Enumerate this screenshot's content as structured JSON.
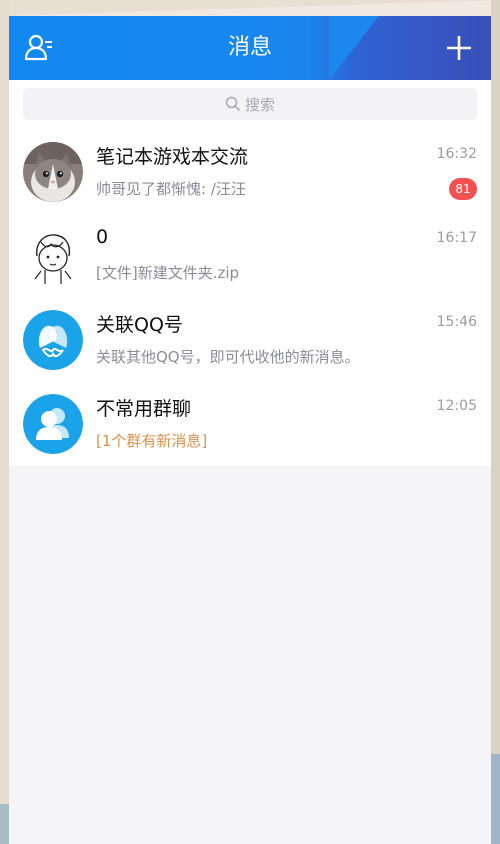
{
  "header": {
    "title": "消息",
    "left_icon": "contacts-icon",
    "right_icon": "plus-icon",
    "accent": "#1289f0"
  },
  "search": {
    "placeholder": "搜索",
    "icon": "search-icon"
  },
  "conversations": [
    {
      "name": "笔记本游戏本交流",
      "preview": "帅哥见了都惭愧: /汪汪",
      "time": "16:32",
      "unread": "81",
      "avatar": "cat-photo"
    },
    {
      "name": "0",
      "preview": "[文件]新建文件夹.zip",
      "time": "16:17",
      "avatar": "sketch-girl"
    },
    {
      "name": "关联QQ号",
      "preview": "关联其他QQ号，即可代收他的新消息。",
      "time": "15:46",
      "avatar": "linked-accounts-icon"
    },
    {
      "name": "不常用群聊",
      "preview": "[1个群有新消息]",
      "time": "12:05",
      "avatar": "group-icon"
    }
  ],
  "colors": {
    "badge": "#f2514f",
    "preview_highlight": "#e0904a",
    "avatar_blue": "#1aa3e8"
  }
}
